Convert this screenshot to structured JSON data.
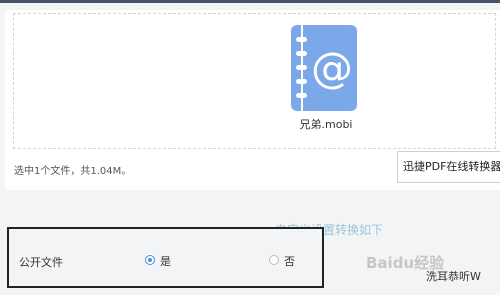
{
  "upload": {
    "file_name": "兄弟.mobi",
    "status": "选中1个文件，共1.04M。",
    "converter_button": "迅捷PDF在线转换器"
  },
  "settings": {
    "custom_link": "自定义设置转换如下",
    "public_file_label": "公开文件",
    "option_yes": "是",
    "option_no": "否",
    "selected": "是"
  },
  "watermark": {
    "brand": "Baidu经验",
    "credit": "洗耳恭听W"
  },
  "colors": {
    "file_icon": "#7aa8e8",
    "radio_selected": "#4a8fe0",
    "link": "#9cc6dd"
  },
  "icons": {
    "file": "mobi-file-icon",
    "radio_on": "radio-checked-icon",
    "radio_off": "radio-unchecked-icon"
  }
}
